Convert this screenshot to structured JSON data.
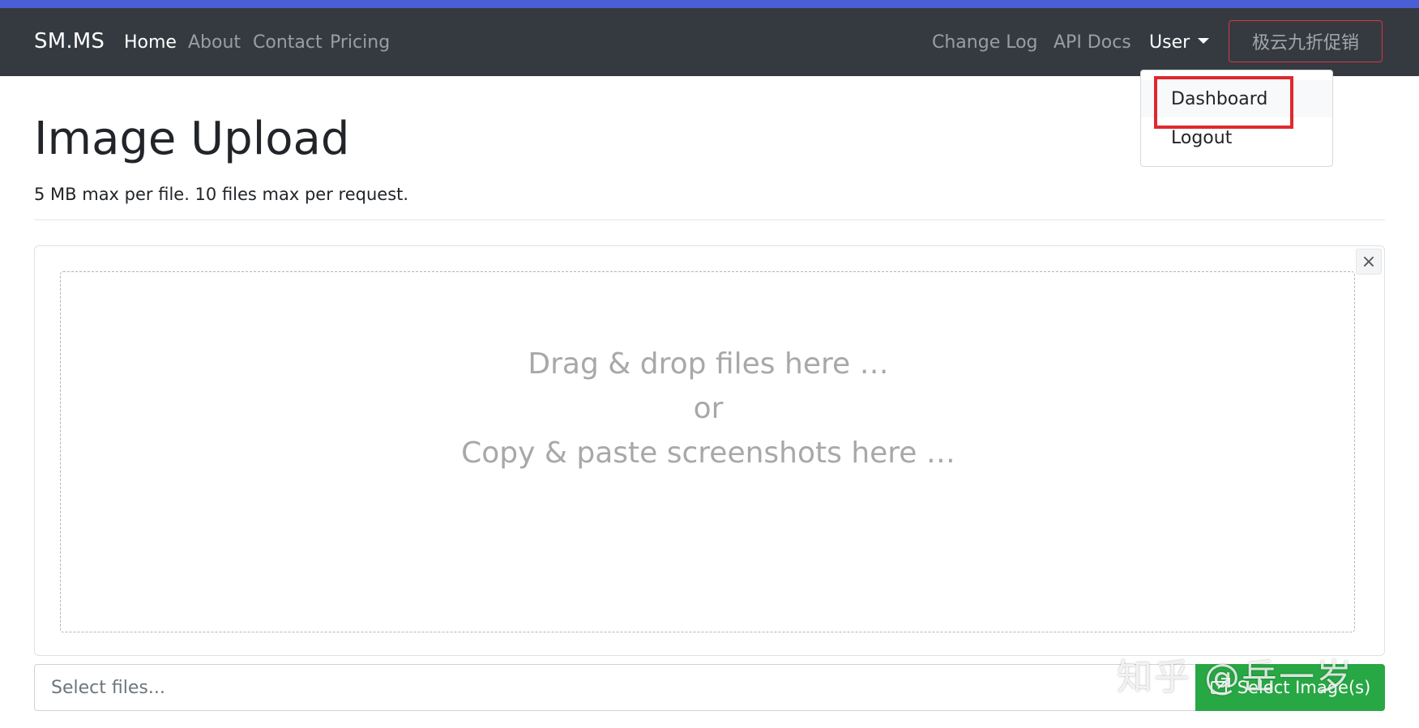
{
  "navbar": {
    "brand": "SM.MS",
    "left_links": [
      {
        "label": "Home"
      },
      {
        "label": "About"
      },
      {
        "label": "Contact"
      },
      {
        "label": "Pricing"
      }
    ],
    "right_links": [
      {
        "label": "Change Log"
      },
      {
        "label": "API Docs"
      }
    ],
    "user_menu_label": "User",
    "promo_button_label": "极云九折促销"
  },
  "user_dropdown": {
    "items": [
      {
        "label": "Dashboard"
      },
      {
        "label": "Logout"
      }
    ]
  },
  "main": {
    "title": "Image Upload",
    "subtitle": "5 MB max per file. 10 files max per request.",
    "dropzone_lines": [
      "Drag & drop files here …",
      "or",
      "Copy & paste screenshots here …"
    ],
    "close_label": "×",
    "file_input_placeholder": "Select files...",
    "select_button_label": "Select Image(s)"
  },
  "watermark": "知乎 @岳一岁",
  "colors": {
    "accent_bar": "#4a5fd6",
    "navbar_bg": "#343a40",
    "success": "#28a745",
    "danger": "#dc3545",
    "highlight": "#e0282e"
  },
  "icons": {
    "dropdown_caret": "caret-down-icon",
    "close": "close-icon",
    "upload": "upload-icon"
  }
}
